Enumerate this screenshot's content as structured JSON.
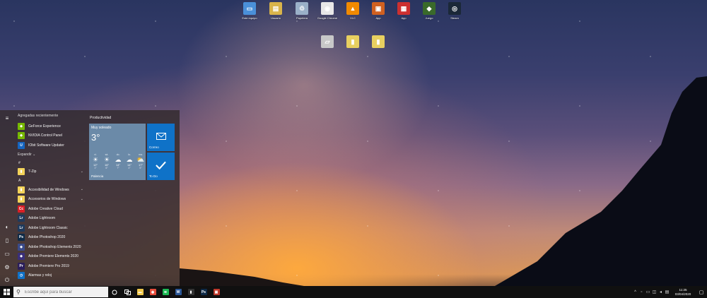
{
  "desktop": {
    "icons": [
      {
        "name": "desktop-icon-1",
        "label": "Este equipo",
        "color": "#4a90d9",
        "glyph": "▭"
      },
      {
        "name": "desktop-icon-2",
        "label": "Usuario",
        "color": "#d9b44a",
        "glyph": "▤"
      },
      {
        "name": "desktop-icon-3",
        "label": "Papelera",
        "color": "#9ab0c8",
        "glyph": "♲"
      },
      {
        "name": "desktop-icon-4",
        "label": "Google Chrome",
        "color": "#e8e8e8",
        "glyph": "◉"
      },
      {
        "name": "desktop-icon-5",
        "label": "VLC",
        "color": "#f08a00",
        "glyph": "▲"
      },
      {
        "name": "desktop-icon-6",
        "label": "App",
        "color": "#d06020",
        "glyph": "▣"
      },
      {
        "name": "desktop-icon-7",
        "label": "App",
        "color": "#cc3030",
        "glyph": "▦"
      },
      {
        "name": "desktop-icon-8",
        "label": "Juego",
        "color": "#3a6a2a",
        "glyph": "◆"
      },
      {
        "name": "desktop-icon-9",
        "label": "Steam",
        "color": "#1b2838",
        "glyph": "◎"
      },
      {
        "name": "desktop-icon-10",
        "label": "",
        "color": "#c8c8c8",
        "glyph": "▱"
      },
      {
        "name": "desktop-icon-11",
        "label": "",
        "color": "#e8d060",
        "glyph": "▮"
      },
      {
        "name": "desktop-icon-12",
        "label": "",
        "color": "#e8d060",
        "glyph": "▮"
      }
    ]
  },
  "start_menu": {
    "recent_header": "Agregadas recientemente",
    "recent": [
      {
        "label": "GeForce Experience",
        "color": "#76b900",
        "glyph": "◆"
      },
      {
        "label": "NVIDIA Control Panel",
        "color": "#76b900",
        "glyph": "◆"
      },
      {
        "label": "IObit Software Updater",
        "color": "#1565c0",
        "glyph": "U"
      }
    ],
    "expand_label": "Expandir ⌄",
    "letter_hash": "#",
    "hash_apps": [
      {
        "label": "7-Zip",
        "color": "#f3d35a",
        "glyph": "▮",
        "chevron": "⌄"
      }
    ],
    "letter_a": "A",
    "a_apps": [
      {
        "label": "Accesibilidad de Windows",
        "color": "#f3d35a",
        "glyph": "▮",
        "chevron": "⌄"
      },
      {
        "label": "Accesorios de Windows",
        "color": "#f3d35a",
        "glyph": "▮",
        "chevron": "⌄"
      },
      {
        "label": "Adobe Creative Cloud",
        "color": "#da1f26",
        "glyph": "Cc",
        "chevron": ""
      },
      {
        "label": "Adobe Lightroom",
        "color": "#1f3a5c",
        "glyph": "Lr",
        "chevron": ""
      },
      {
        "label": "Adobe Lightroom Classic",
        "color": "#1f3a5c",
        "glyph": "Lr",
        "chevron": ""
      },
      {
        "label": "Adobe Photoshop 2020",
        "color": "#0e2a47",
        "glyph": "Ps",
        "chevron": ""
      },
      {
        "label": "Adobe Photoshop Elements 2020",
        "color": "#3a4b8a",
        "glyph": "◈",
        "chevron": ""
      },
      {
        "label": "Adobe Premiere Elements 2020",
        "color": "#3a2f7a",
        "glyph": "◈",
        "chevron": ""
      },
      {
        "label": "Adobe Premiere Pro 2019",
        "color": "#2a1d5a",
        "glyph": "Pr",
        "chevron": ""
      },
      {
        "label": "Alarmas y reloj",
        "color": "#0f72c8",
        "glyph": "◷",
        "chevron": ""
      }
    ],
    "tiles_header": "Productividad",
    "weather": {
      "condition": "Muy soleado",
      "temp": "3°",
      "city": "Palencia",
      "days": [
        {
          "d": "vi.",
          "ic": "☀",
          "hi": "12°",
          "lo": "1°"
        },
        {
          "d": "sá.",
          "ic": "☀",
          "hi": "16°",
          "lo": "6°"
        },
        {
          "d": "do.",
          "ic": "☁",
          "hi": "14°",
          "lo": "7°"
        },
        {
          "d": "lu.",
          "ic": "☁",
          "hi": "14°",
          "lo": "4°"
        },
        {
          "d": "ma.",
          "ic": "⛅",
          "hi": "17°",
          "lo": "5°"
        }
      ]
    },
    "tile_mail": "Correo",
    "tile_todo": "To Do"
  },
  "taskbar": {
    "search_placeholder": "Escribe aquí para buscar",
    "apps": [
      {
        "name": "taskbar-explorer",
        "color": "#f2c94c",
        "glyph": "▬"
      },
      {
        "name": "taskbar-chrome",
        "color": "#e74c3c",
        "glyph": "◉"
      },
      {
        "name": "taskbar-spotify",
        "color": "#1db954",
        "glyph": "≋"
      },
      {
        "name": "taskbar-word",
        "color": "#2b5797",
        "glyph": "W"
      },
      {
        "name": "taskbar-app",
        "color": "#333",
        "glyph": "▮"
      },
      {
        "name": "taskbar-photoshop",
        "color": "#0e2a47",
        "glyph": "Ps"
      },
      {
        "name": "taskbar-app2",
        "color": "#c0392b",
        "glyph": "▣"
      }
    ],
    "time": "11:25",
    "date": "03/04/2020"
  }
}
